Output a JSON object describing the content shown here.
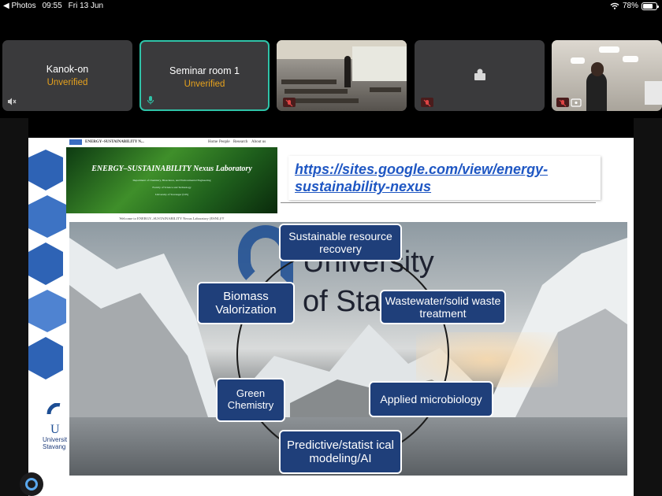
{
  "status_bar": {
    "back_app": "◀ Photos",
    "time": "09:55",
    "date": "Fri 13 Jun",
    "battery_percent": "78%",
    "battery_level": 0.78
  },
  "participants": [
    {
      "name": "Kanok-on",
      "status": "Unverified",
      "muted": true
    },
    {
      "name": "Seminar room 1",
      "status": "Unverified",
      "active": true
    },
    {
      "name": "",
      "status": "",
      "video": "classroom"
    },
    {
      "name": "",
      "status": "",
      "video": "avatar"
    },
    {
      "name": "",
      "status": "",
      "video": "person"
    }
  ],
  "slide": {
    "website": {
      "nav_title": "ENERGY–SUSTAINABILITY N...",
      "nav_links": [
        "Home",
        "People",
        "Research",
        "About us"
      ],
      "banner_title": "ENERGY–SUSTAINABILITY Nexus Laboratory",
      "banner_line1": "Department of Chemistry, Bioscience, and Environmental Engineering",
      "banner_line2": "Faculty of Science and Technology",
      "banner_line3": "University of Stavanger (UiS)",
      "welcome": "Welcome to ENERGY–SUSTAINABILITY Nexus Laboratory (ESNL)!!!"
    },
    "url": "https://sites.google.com/view/energy-sustainability-nexus",
    "university_text_1": "University",
    "university_text_2": "of Sta",
    "nodes": {
      "resource_recovery": "Sustainable resource recovery",
      "biomass": "Biomass Valorization",
      "wastewater": "Wastewater/solid waste treatment",
      "green_chemistry": "Green Chemistry",
      "microbiology": "Applied microbiology",
      "modeling": "Predictive/statist ical modeling/AI"
    },
    "logo_bottom_line1": "Universit",
    "logo_bottom_line2": "Stavang"
  },
  "colors": {
    "node_bg": "#1f3f7a",
    "active_border": "#2fc3a8",
    "unverified": "#e7a21d",
    "link": "#1f57c3"
  }
}
